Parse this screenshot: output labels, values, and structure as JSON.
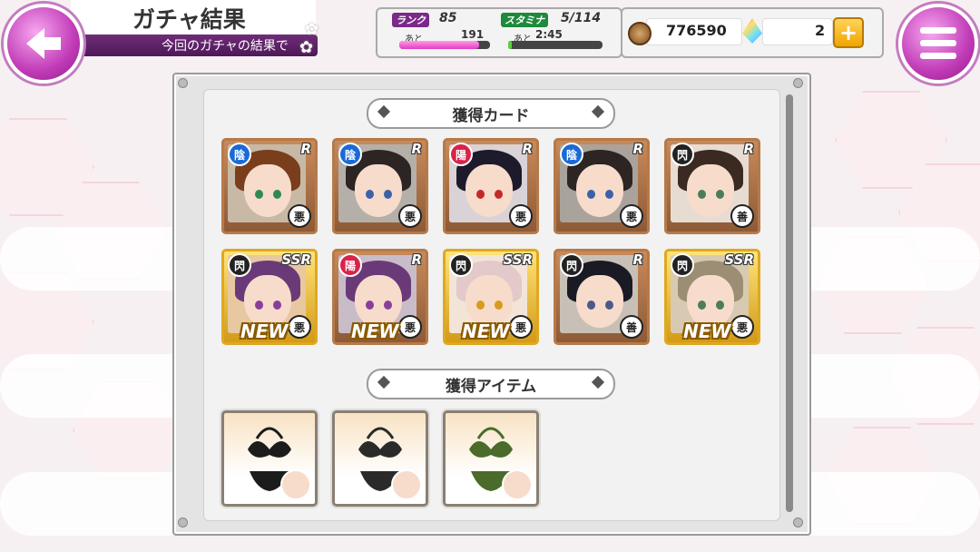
{
  "header": {
    "title": "ガチャ結果",
    "subtitle": "今回のガチャの結果で"
  },
  "status": {
    "rank_label": "ランク",
    "rank_value": "85",
    "rank_remaining_prefix": "あと",
    "rank_remaining": "191",
    "rank_progress": 0.88,
    "stamina_label": "スタミナ",
    "stamina_value": "5/114",
    "stamina_remaining_prefix": "あと",
    "stamina_remaining": "2:45",
    "stamina_progress": 0.04
  },
  "currency": {
    "coins": "776590",
    "gems": "2",
    "plus_label": "+"
  },
  "sections": {
    "cards_header": "獲得カード",
    "items_header": "獲得アイテム"
  },
  "cards": [
    {
      "attr": "陰",
      "attr_color": "#1a6ad6",
      "rarity": "R",
      "align": "悪",
      "new": "",
      "hair": "#7a3e1c",
      "eye": "#2e8a55",
      "bg": "#c7b9a6"
    },
    {
      "attr": "陰",
      "attr_color": "#1a6ad6",
      "rarity": "R",
      "align": "悪",
      "new": "",
      "hair": "#2c2524",
      "eye": "#3b62a8",
      "bg": "#b4b0a9"
    },
    {
      "attr": "陽",
      "attr_color": "#d8234b",
      "rarity": "R",
      "align": "悪",
      "new": "",
      "hair": "#1d1a2c",
      "eye": "#c22a2a",
      "bg": "#d9d2d6"
    },
    {
      "attr": "陰",
      "attr_color": "#1a6ad6",
      "rarity": "R",
      "align": "悪",
      "new": "",
      "hair": "#2c2524",
      "eye": "#3b62a8",
      "bg": "#a9a39c"
    },
    {
      "attr": "閃",
      "attr_color": "#222222",
      "rarity": "R",
      "align": "善",
      "new": "",
      "hair": "#3a2a22",
      "eye": "#4b7e58",
      "bg": "#e7dcd2"
    },
    {
      "attr": "閃",
      "attr_color": "#222222",
      "rarity": "SSR",
      "align": "悪",
      "new": "NEW",
      "hair": "#6a3a78",
      "eye": "#8a3e9a",
      "bg": "#e8c8a0"
    },
    {
      "attr": "陽",
      "attr_color": "#d8234b",
      "rarity": "R",
      "align": "悪",
      "new": "NEW",
      "hair": "#6a3a78",
      "eye": "#8a3e9a",
      "bg": "#c9bcc9"
    },
    {
      "attr": "閃",
      "attr_color": "#222222",
      "rarity": "SSR",
      "align": "悪",
      "new": "NEW",
      "hair": "#e3c9c9",
      "eye": "#d79a1e",
      "bg": "#f3e4d8"
    },
    {
      "attr": "閃",
      "attr_color": "#222222",
      "rarity": "R",
      "align": "善",
      "new": "",
      "hair": "#1a1a24",
      "eye": "#4a5a8a",
      "bg": "#c8c0b6"
    },
    {
      "attr": "閃",
      "attr_color": "#222222",
      "rarity": "SSR",
      "align": "悪",
      "new": "NEW",
      "hair": "#9c8e74",
      "eye": "#4b7e58",
      "bg": "#d8c9b2"
    }
  ],
  "items": [
    {
      "kind": "black-bikini",
      "color": "#1c1c1c"
    },
    {
      "kind": "striped-bikini",
      "color": "#2a2a2a"
    },
    {
      "kind": "camo-bikini",
      "color": "#4a6b2a"
    }
  ]
}
